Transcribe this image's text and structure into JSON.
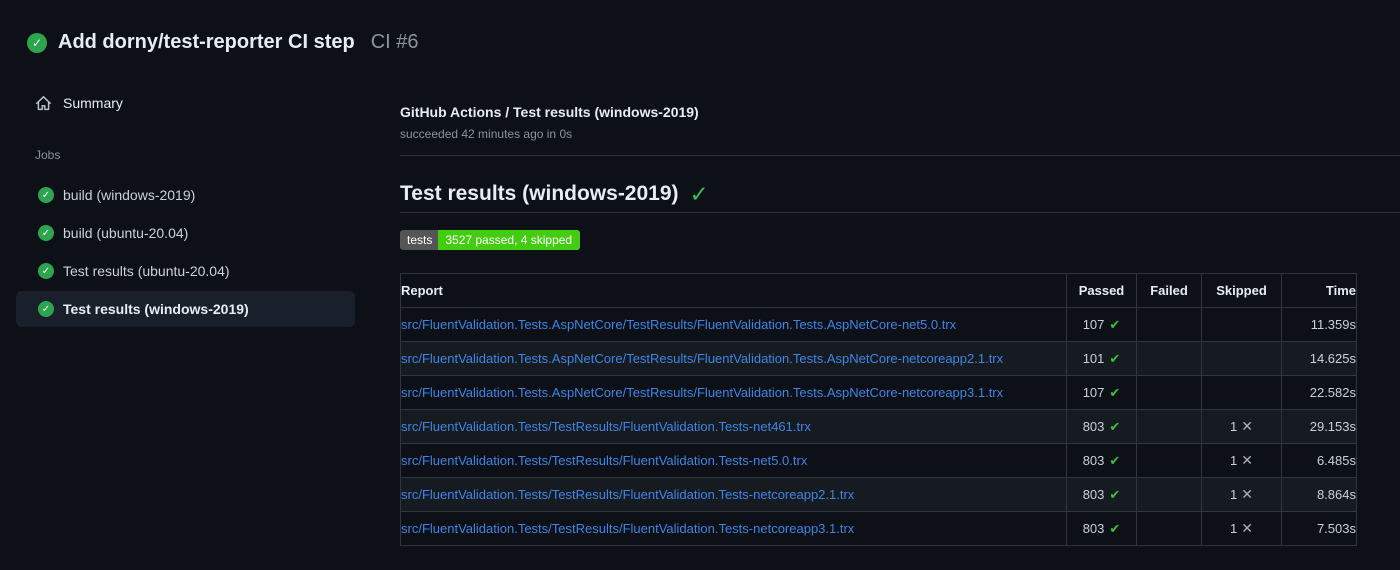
{
  "colors": {
    "background": "#0d1117",
    "accent_green": "#2da44e",
    "check_green": "#3cc03c",
    "link_blue": "#4184e4",
    "badge_label_bg": "#555555",
    "badge_value_bg": "#44cc11",
    "muted_text": "#8b949e",
    "row_stripe": "#161b22",
    "border": "#30363d"
  },
  "icons": {
    "status_check_glyph": "✓",
    "table_check_glyph": "✔",
    "table_cross_glyph": "✕"
  },
  "header": {
    "title": "Add dorny/test-reporter CI step",
    "run_number": "CI #6"
  },
  "sidebar": {
    "summary_label": "Summary",
    "jobs_label": "Jobs",
    "jobs": [
      {
        "label": "build (windows-2019)",
        "selected": false
      },
      {
        "label": "build (ubuntu-20.04)",
        "selected": false
      },
      {
        "label": "Test results (ubuntu-20.04)",
        "selected": false
      },
      {
        "label": "Test results (windows-2019)",
        "selected": true
      }
    ]
  },
  "main": {
    "job_title": "GitHub Actions / Test results (windows-2019)",
    "job_status": "succeeded 42 minutes ago in 0s",
    "section_heading": "Test results (windows-2019)",
    "badge": {
      "label": "tests",
      "value": "3527 passed, 4 skipped"
    },
    "table": {
      "headers": [
        "Report",
        "Passed",
        "Failed",
        "Skipped",
        "Time"
      ],
      "rows": [
        {
          "report": "src/FluentValidation.Tests.AspNetCore/TestResults/FluentValidation.Tests.AspNetCore-net5.0.trx",
          "passed": "107",
          "failed": "",
          "skipped": "",
          "time": "11.359s"
        },
        {
          "report": "src/FluentValidation.Tests.AspNetCore/TestResults/FluentValidation.Tests.AspNetCore-netcoreapp2.1.trx",
          "passed": "101",
          "failed": "",
          "skipped": "",
          "time": "14.625s"
        },
        {
          "report": "src/FluentValidation.Tests.AspNetCore/TestResults/FluentValidation.Tests.AspNetCore-netcoreapp3.1.trx",
          "passed": "107",
          "failed": "",
          "skipped": "",
          "time": "22.582s"
        },
        {
          "report": "src/FluentValidation.Tests/TestResults/FluentValidation.Tests-net461.trx",
          "passed": "803",
          "failed": "",
          "skipped": "1",
          "time": "29.153s"
        },
        {
          "report": "src/FluentValidation.Tests/TestResults/FluentValidation.Tests-net5.0.trx",
          "passed": "803",
          "failed": "",
          "skipped": "1",
          "time": "6.485s"
        },
        {
          "report": "src/FluentValidation.Tests/TestResults/FluentValidation.Tests-netcoreapp2.1.trx",
          "passed": "803",
          "failed": "",
          "skipped": "1",
          "time": "8.864s"
        },
        {
          "report": "src/FluentValidation.Tests/TestResults/FluentValidation.Tests-netcoreapp3.1.trx",
          "passed": "803",
          "failed": "",
          "skipped": "1",
          "time": "7.503s"
        }
      ]
    }
  }
}
